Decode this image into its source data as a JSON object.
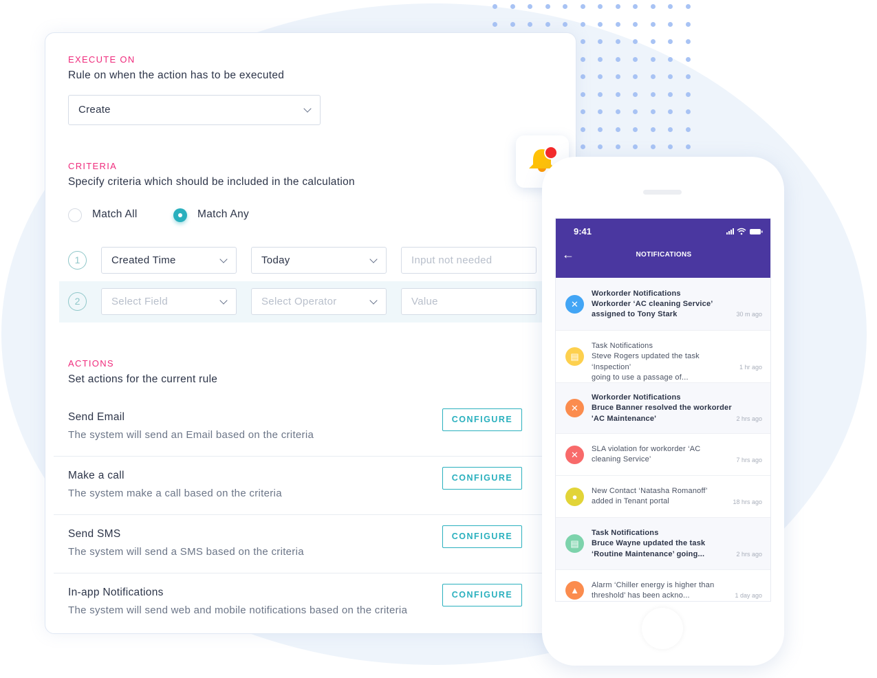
{
  "colors": {
    "accent": "#2ab0be",
    "label": "#ef2b7c",
    "header": "#4a37a0"
  },
  "execute": {
    "label": "EXECUTE ON",
    "description": "Rule on when the action has to be executed",
    "selected": "Create"
  },
  "criteria": {
    "label": "CRITERIA",
    "description": "Specify criteria which should be included in the calculation",
    "match_all": "Match All",
    "match_any": "Match Any",
    "selected_match": "Match Any",
    "rows": [
      {
        "num": "1",
        "field": "Created Time",
        "operator": "Today",
        "value_placeholder": "Input not needed"
      },
      {
        "num": "2",
        "field_placeholder": "Select Field",
        "operator_placeholder": "Select Operator",
        "value_placeholder": "Value"
      }
    ]
  },
  "actions": {
    "label": "ACTIONS",
    "description": "Set actions for the current rule",
    "configure": "CONFIGURE",
    "items": [
      {
        "title": "Send Email",
        "desc": "The system will send an Email based on the criteria"
      },
      {
        "title": "Make a call",
        "desc": "The system make a call based on the criteria"
      },
      {
        "title": "Send SMS",
        "desc": "The system will send a SMS based on the criteria"
      },
      {
        "title": "In-app Notifications",
        "desc": "The system will send web and mobile notifications based on the criteria"
      }
    ]
  },
  "phone": {
    "time": "9:41",
    "title": "NOTIFICATIONS",
    "notifications": [
      {
        "icon": "wrench-icon",
        "color": "#42a5f5",
        "lines": [
          "Workorder Notifications",
          "Workorder ‘AC cleaning Service’",
          "assigned to Tony Stark"
        ],
        "ago": "30 m ago",
        "bold": true,
        "grey": true
      },
      {
        "icon": "clipboard-icon",
        "color": "#fdd04e",
        "lines": [
          "Task Notifications",
          "Steve Rogers updated the task ‘Inspection’",
          "going to use a passage of..."
        ],
        "ago": "1 hr ago",
        "bold": false,
        "grey": false
      },
      {
        "icon": "wrench-icon",
        "color": "#fb8c4e",
        "lines": [
          "Workorder Notifications",
          "Bruce Banner resolved the workorder",
          "'AC Maintenance'"
        ],
        "ago": "2 hrs ago",
        "bold": true,
        "grey": true
      },
      {
        "icon": "wrench-icon",
        "color": "#f86a6a",
        "lines": [
          "SLA violation for workorder ‘AC",
          "cleaning Service’"
        ],
        "ago": "7 hrs ago",
        "bold": false,
        "grey": false
      },
      {
        "icon": "user-icon",
        "color": "#e2d438",
        "lines": [
          "New Contact ‘Natasha Romanoff’",
          "added in Tenant portal"
        ],
        "ago": "18 hrs ago",
        "bold": false,
        "grey": false
      },
      {
        "icon": "clipboard-icon",
        "color": "#7dd3ac",
        "lines": [
          "Task Notifications",
          "Bruce Wayne updated the task",
          "‘Routine Maintenance’ going..."
        ],
        "ago": "2 hrs ago",
        "bold": true,
        "grey": true
      },
      {
        "icon": "alarm-icon",
        "color": "#fb8c4e",
        "lines": [
          "Alarm ‘Chiller energy is higher than",
          "threshold’ has been ackno..."
        ],
        "ago": "1 day ago",
        "bold": false,
        "grey": false
      }
    ]
  }
}
